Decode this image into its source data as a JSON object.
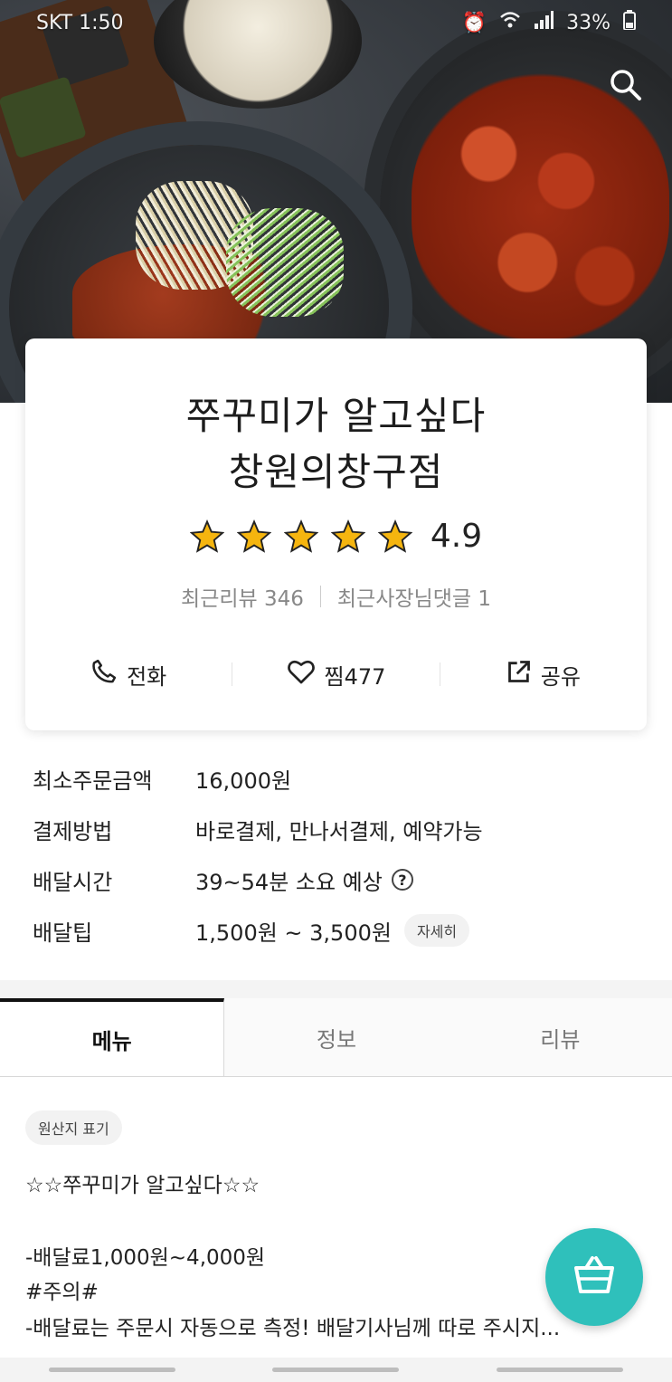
{
  "status_bar": {
    "carrier": "SKT 1:50",
    "battery": "33%"
  },
  "store": {
    "name_line1": "쭈꾸미가 알고싶다",
    "name_line2": "창원의창구점",
    "rating": "4.9",
    "stars": 5,
    "recent_reviews": "최근리뷰 346",
    "owner_replies": "최근사장님댓글 1"
  },
  "actions": {
    "call": "전화",
    "favorite": "찜477",
    "share": "공유"
  },
  "details": {
    "min_order_label": "최소주문금액",
    "min_order_value": "16,000원",
    "payment_label": "결제방법",
    "payment_value": "바로결제, 만나서결제, 예약가능",
    "delivery_time_label": "배달시간",
    "delivery_time_value": "39~54분 소요 예상",
    "delivery_tip_label": "배달팁",
    "delivery_tip_value": "1,500원 ~ 3,500원",
    "delivery_tip_detail": "자세히"
  },
  "tabs": {
    "menu": "메뉴",
    "info": "정보",
    "review": "리뷰"
  },
  "notice": {
    "origin_label": "원산지 표기",
    "line1": "☆☆쭈꾸미가 알고싶다☆☆",
    "line2": "-배달료1,000원~4,000원",
    "line3": "#주의#",
    "line4": "-배달료는 주문시 자동으로 측정! 배달기사님께 따로 주시지..."
  },
  "colors": {
    "star": "#f5b50f",
    "fab": "#2fc0bb"
  },
  "icons": {
    "search": "search-icon",
    "call": "phone-icon",
    "favorite": "heart-icon",
    "share": "share-icon",
    "help": "question-circle-icon",
    "cart": "basket-icon"
  }
}
